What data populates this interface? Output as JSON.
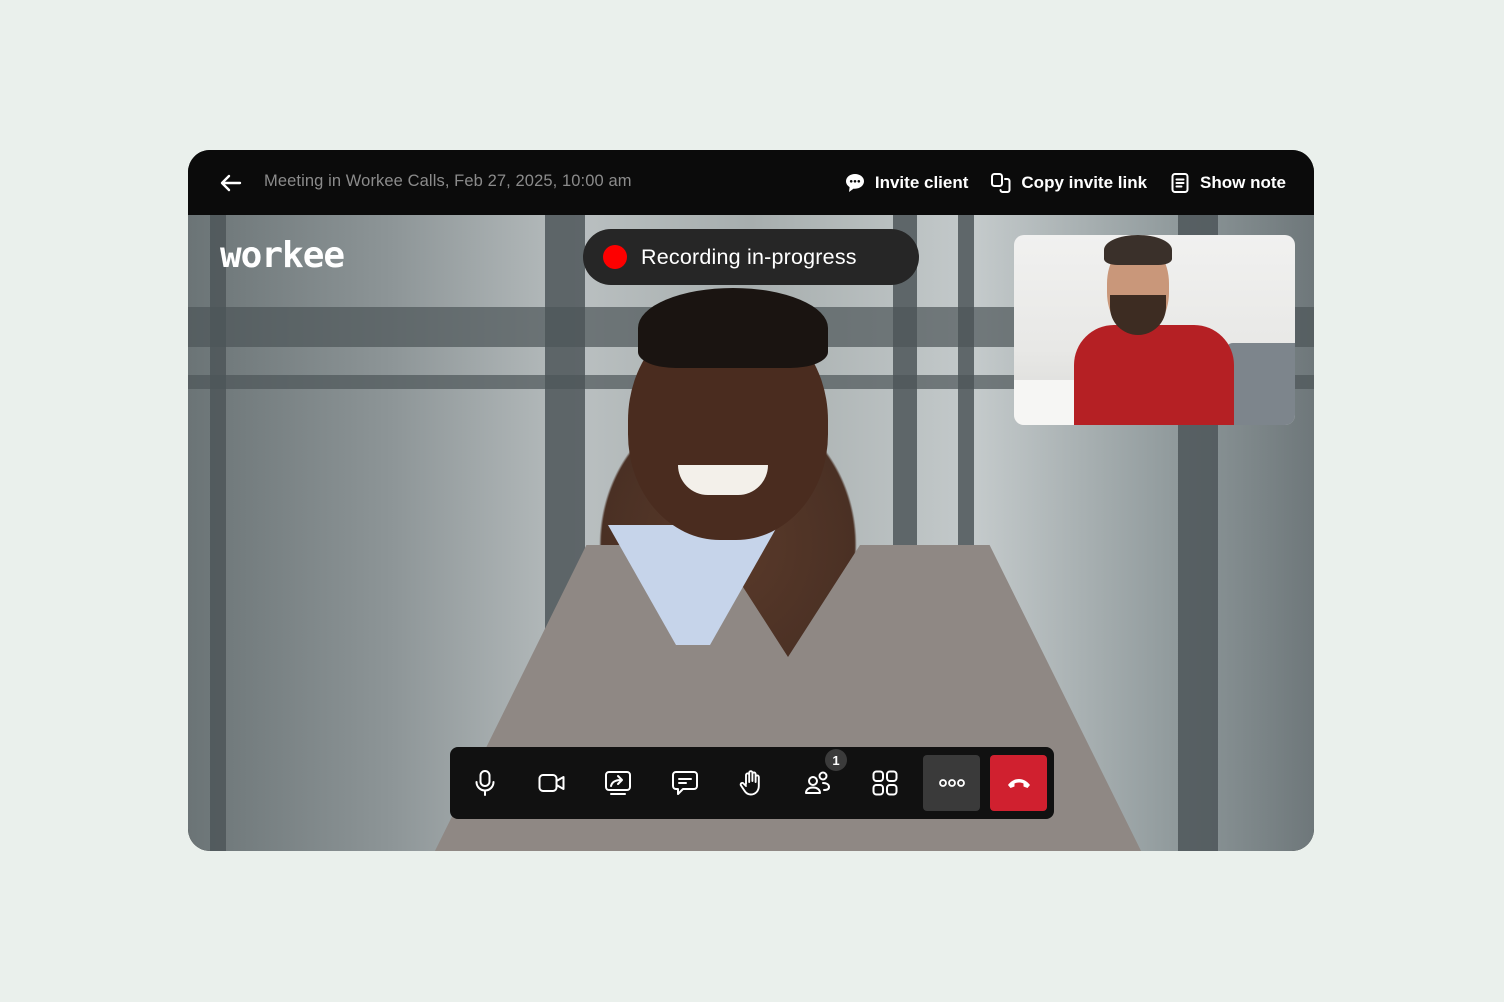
{
  "topbar": {
    "back_icon": "arrow-left-icon",
    "meeting_title": "Meeting in Workee Calls, Feb 27, 2025, 10:00 am",
    "actions": [
      {
        "label": "Invite client",
        "icon": "chat-bubble-icon"
      },
      {
        "label": "Copy invite link",
        "icon": "copy-icon"
      },
      {
        "label": "Show note",
        "icon": "note-icon"
      }
    ]
  },
  "stage": {
    "logo": "workee",
    "recording": {
      "label": "Recording in-progress",
      "dot_color": "#fe0000"
    }
  },
  "toolbar": {
    "buttons": [
      {
        "name": "microphone",
        "icon": "microphone-icon"
      },
      {
        "name": "camera",
        "icon": "video-camera-icon"
      },
      {
        "name": "share-screen",
        "icon": "share-screen-icon"
      },
      {
        "name": "chat",
        "icon": "chat-icon"
      },
      {
        "name": "raise-hand",
        "icon": "hand-icon"
      },
      {
        "name": "participants",
        "icon": "participants-icon",
        "badge": "1"
      },
      {
        "name": "layout",
        "icon": "grid-icon"
      },
      {
        "name": "more",
        "icon": "more-dots-icon"
      },
      {
        "name": "end-call",
        "icon": "phone-hangup-icon"
      }
    ],
    "end_call_color": "#d0202f"
  }
}
